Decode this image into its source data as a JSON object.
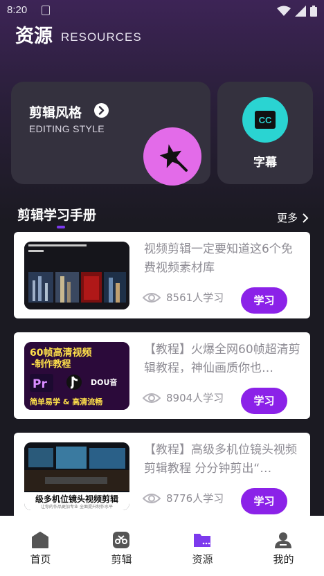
{
  "status_bar": {
    "time": "8:20"
  },
  "header": {
    "title": "资源",
    "subtitle": "RESOURCES"
  },
  "feature_cards": {
    "editing_style": {
      "title": "剪辑风格",
      "subtitle": "EDITING STYLE"
    },
    "subtitles": {
      "badge": "CC",
      "label": "字幕"
    }
  },
  "section": {
    "title": "剪辑学习手册",
    "more_label": "更多"
  },
  "articles": [
    {
      "title": "视频剪辑一定要知道这6个免费视频素材库",
      "views": "8561人学习",
      "button": "学习"
    },
    {
      "title": "【教程】火爆全网60帧超清剪辑教程，神仙画质你也…",
      "views": "8904人学习",
      "button": "学习",
      "thumb_text": {
        "line1": "60帧高清视频",
        "line2": "-制作教程",
        "pr": "Pr",
        "dou": "DOU音",
        "bottom": "简单易学 & 高清流畅"
      }
    },
    {
      "title": "【教程】高级多机位镜头视频剪辑教程 分分钟剪出“…",
      "views": "8776人学习",
      "button": "学习",
      "thumb_text": {
        "banner": "级多机位镜头视频剪辑",
        "caption": "让你的作品更加专业 全面提升制作水平"
      }
    }
  ],
  "tabbar": [
    {
      "label": "首页",
      "icon": "home-icon"
    },
    {
      "label": "剪辑",
      "icon": "scissors-icon"
    },
    {
      "label": "资源",
      "icon": "folder-icon",
      "active": true
    },
    {
      "label": "我的",
      "icon": "person-icon"
    }
  ],
  "colors": {
    "accent": "#8b22e8",
    "pink": "#e36be9",
    "teal": "#2ad4d2",
    "active_tab": "#7c3aed"
  }
}
